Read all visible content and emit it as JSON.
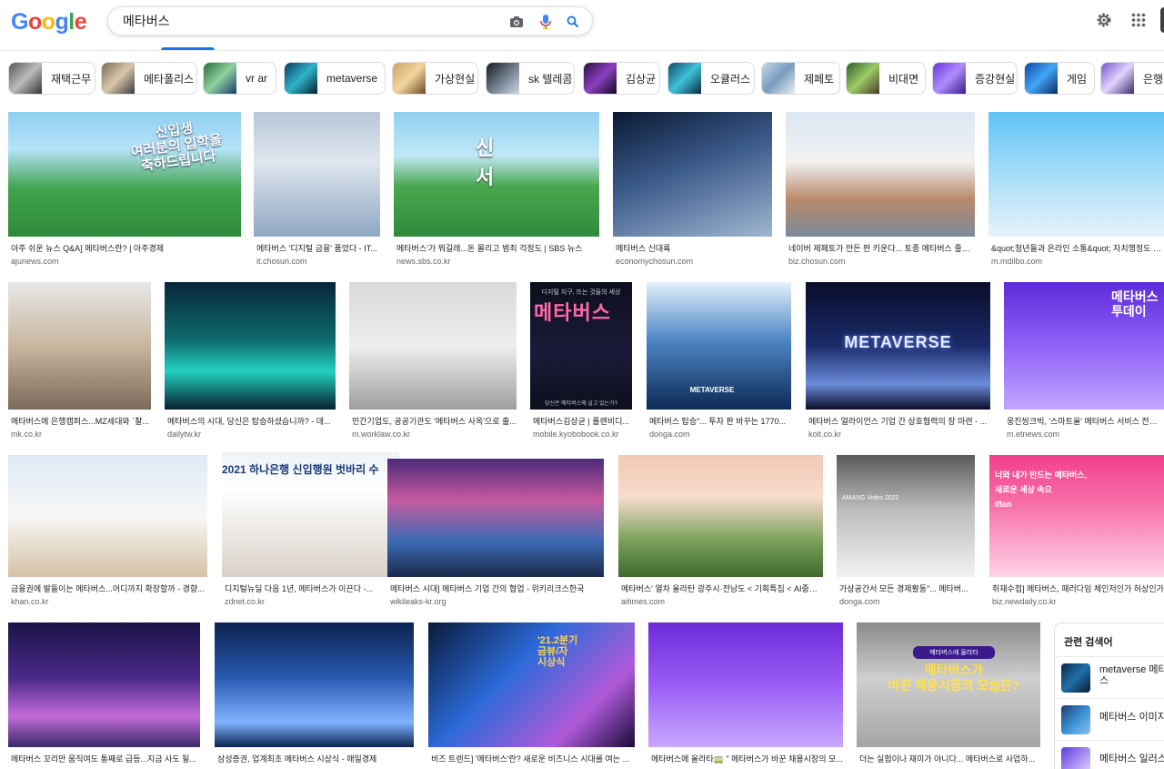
{
  "header": {
    "logo": [
      "G",
      "o",
      "o",
      "g",
      "l",
      "e"
    ],
    "logo_colors": [
      "#4285F4",
      "#EA4335",
      "#FBBC05",
      "#4285F4",
      "#34A853",
      "#EA4335"
    ],
    "search_value": "메타버스",
    "icons": {
      "camera": "camera-icon",
      "mic": "microphone-icon",
      "search": "search-icon",
      "settings": "gear-icon",
      "apps": "apps-grid-icon"
    }
  },
  "chips": [
    {
      "label": "재택근무"
    },
    {
      "label": "메타폴리스"
    },
    {
      "label": "vr ar"
    },
    {
      "label": "metaverse"
    },
    {
      "label": "가상현실"
    },
    {
      "label": "sk 텔레콤"
    },
    {
      "label": "김상균"
    },
    {
      "label": "오큘러스"
    },
    {
      "label": "제페토"
    },
    {
      "label": "비대면"
    },
    {
      "label": "증강현실"
    },
    {
      "label": "게임"
    },
    {
      "label": "은행"
    }
  ],
  "results": [
    {
      "title": "아주 쉬운 뉴스 Q&A] 메타버스란? | 아주경제",
      "source": "ajunews.com"
    },
    {
      "title": "메타버스 '디지털 금융' 품었다 - IT...",
      "source": "it.chosun.com"
    },
    {
      "title": "메타버스'가 뭐길래...돈 몰리고 범죄 걱정도 | SBS 뉴스",
      "source": "news.sbs.co.kr"
    },
    {
      "title": "메타버스 신대륙",
      "source": "economychosun.com"
    },
    {
      "title": "네이버 제페토가 만든 판 키운다... 토종 메타버스 줄줄...",
      "source": "biz.chosun.com"
    },
    {
      "title": "&quot;청년들과 온라인 소통&quot; 자치행정도 메타버스",
      "source": "m.mdilbo.com"
    },
    {
      "title": "메타버스에 은행캠퍼스...MZ세대와 `찰...",
      "source": "mk.co.kr"
    },
    {
      "title": "메타버스의 시대, 당신은 탑승하셨습니까? - 데...",
      "source": "dailytw.kr"
    },
    {
      "title": "민간기업도, 공공기관도 '메타버스 사옥'으로 출...",
      "source": "m.worklaw.co.kr"
    },
    {
      "title": "메타버스김상균 | 플렌비디...",
      "source": "mobile.kyobobook.co.kr"
    },
    {
      "title": "메타버스 탑승\"... 투자 판 바꾸는 1770...",
      "source": "donga.com"
    },
    {
      "title": "메타버스 얼라이언스 기업 간 상호협력의 장 마련 - ...",
      "source": "koit.co.kr"
    },
    {
      "title": "웅진씽크빅, '스마트올' 메타버스 서비스 전면 개편",
      "source": "m.etnews.com"
    },
    {
      "title": "금융권에 발들이는 메타버스...어디까지 확장할까 - 경향...",
      "source": "khan.co.kr"
    },
    {
      "title": "디지털뉴딜 다음 1년, 메타버스가 이끈다 -...",
      "source": "zdnet.co.kr"
    },
    {
      "title": "메타버스 시대] 메타버스 기업 간의 협업 - 위키리크스한국",
      "source": "wikileaks-kr.org"
    },
    {
      "title": "메타버스' 열차 올라탄 광주시·전남도 < 기획특집 < AI중심...",
      "source": "aitimes.com"
    },
    {
      "title": "가상공간서 모든 경제활동\"... 메타버...",
      "source": "donga.com"
    },
    {
      "title": "취재수첩] 메타버스, 패러다임 체인저인가 허상인가",
      "source": "biz.newdaily.co.kr"
    },
    {
      "title": "메타버스 꼬리만 움직여도 통째로 급등...지금 사도 될...",
      "source": ""
    },
    {
      "title": "삼성증권, 업계최초 메타버스 시상식 - 매일경제",
      "source": ""
    },
    {
      "title": "비즈 트렌드] '메타버스'란? 새로운 비즈니스 시대를 여는 ...",
      "source": ""
    },
    {
      "title": "메타버스에 올라타🚃 \" 메타버스가 바꾼 채용시장의 모...",
      "source": ""
    },
    {
      "title": "더는 실험이나 재미가 아니다... 메타버스로 사업하...",
      "source": ""
    }
  ],
  "image_texts": {
    "r0": "신입생\n여러분의 입학을\n축하드립니다",
    "r2": "신 서",
    "r9_title": "메타버스",
    "r9_top": "디지털 지구, 뜨는 것들의 세상",
    "r9_bottom": "당신은 메타버스에 살고 있는가?",
    "r10": "METAVERSE",
    "r11": "METAVERSE",
    "r12": "메타버스\n투데이",
    "r14": "2021 하나은행 신입행원 벗바리 수",
    "r17": "AMAXG Video 2022",
    "r18": "너와 내가 만드는 메타버스,\n새로운 세상 속으\niflan",
    "r21": "'21.2분기\n금뷰/자\n시상식",
    "r23_tag": "메타버스에 올라타",
    "r23_title": "메타버스가\n바꾼 채용시장의 모습은?"
  },
  "related": {
    "title": "관련 검색어",
    "items": [
      {
        "label": "metaverse 메타버스"
      },
      {
        "label": "메타버스 이미지"
      },
      {
        "label": "메타버스 일러스트"
      }
    ]
  }
}
